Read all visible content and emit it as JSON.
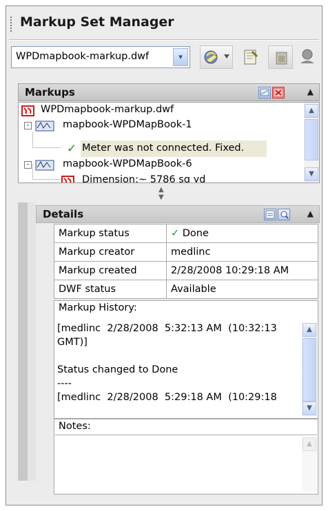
{
  "panel": {
    "title": "Markup Set Manager"
  },
  "toolbar": {
    "file_value": "WPDmapbook-markup.dwf",
    "dropdown_arrow": "▾"
  },
  "markups": {
    "header": "Markups",
    "tree": {
      "root": "WPDmapbook-markup.dwf",
      "sheet1": "mapbook-WPDMapBook-1",
      "markup1": "Meter was not connected.  Fixed.",
      "sheet2": "mapbook-WPDMapBook-6",
      "markup2": "Dimension:~ 5786 sq yd"
    }
  },
  "details": {
    "header": "Details",
    "properties": [
      {
        "key": "Markup status",
        "value": "Done"
      },
      {
        "key": "Markup creator",
        "value": "medlinc"
      },
      {
        "key": "Markup created",
        "value": "2/28/2008 10:29:18 AM"
      },
      {
        "key": "DWF status",
        "value": "Available"
      }
    ],
    "history_label": "Markup History:",
    "history_text": "[medlinc  2/28/2008  5:32:13 AM  (10:32:13\nGMT)]\n\nStatus changed to Done\n----\n[medlinc  2/28/2008  5:29:18 AM  (10:29:18",
    "notes_label": "Notes:"
  },
  "colors": {
    "accent": "#b9cdf1",
    "done_check": "#1a9a1a",
    "markup_red": "#d01818"
  },
  "icons": [
    "grip-icon",
    "dropdown-arrow-icon",
    "publish-icon",
    "markup-doc-icon",
    "camera-icon",
    "marker-icon",
    "markup-red-icon",
    "sheet-icon",
    "done-check-icon",
    "collapse-icon",
    "scroll-up-icon",
    "scroll-down-icon",
    "splitter-icon"
  ]
}
